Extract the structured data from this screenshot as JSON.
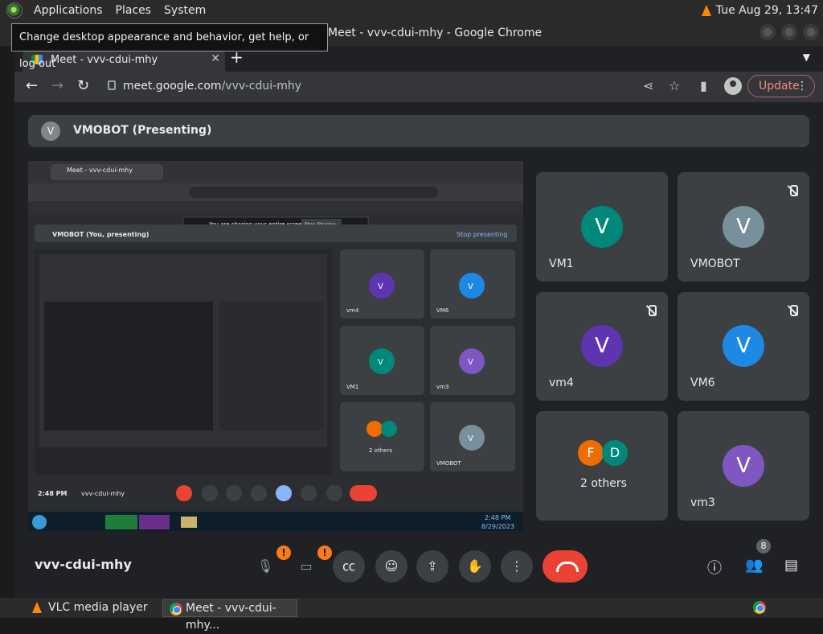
{
  "panel": {
    "menus": [
      "Applications",
      "Places",
      "System"
    ],
    "clock": "Tue Aug 29, 13:47"
  },
  "tooltip": "Change desktop appearance and behavior, get help, or log out",
  "window": {
    "title": "Meet - vvv-cdui-mhy - Google Chrome"
  },
  "browser": {
    "tab_title": "Meet - vvv-cdui-mhy",
    "url_host": "meet.google.com",
    "url_path": "/vvv-cdui-mhy",
    "update_label": "Update"
  },
  "meet": {
    "presenter_initial": "V",
    "presenter_label": "VMOBOT (Presenting)",
    "tiles": [
      {
        "name": "VM1",
        "initial": "V",
        "color": "#00897b",
        "muted": false
      },
      {
        "name": "VMOBOT",
        "initial": "V",
        "color": "#78909c",
        "muted": true
      },
      {
        "name": "vm4",
        "initial": "V",
        "color": "#5e35b1",
        "muted": true
      },
      {
        "name": "VM6",
        "initial": "V",
        "color": "#1e88e5",
        "muted": true
      },
      {
        "name": "2 others",
        "initials": [
          "F",
          "D"
        ],
        "colors": [
          "#ef6c00",
          "#00897b"
        ],
        "muted": false
      },
      {
        "name": "vm3",
        "initial": "V",
        "color": "#7e57c2",
        "muted": false
      }
    ],
    "shared_screen": {
      "nested_bar_label": "VMOBOT (You, presenting)",
      "sharing_notice": "You are sharing your entire screen.",
      "stop_sharing": "Stop Sharing",
      "stop_presenting": "Stop presenting",
      "nested_time": "2:48 PM",
      "nested_code": "vvv-cdui-mhy",
      "nested_tiles": [
        "vm4",
        "VM6",
        "VM1",
        "vm3",
        "2 others",
        "VMOBOT"
      ],
      "taskbar_time": "2:48 PM",
      "taskbar_date": "8/29/2023"
    }
  },
  "bottom": {
    "meeting_code": "vvv-cdui-mhy",
    "warning": "!",
    "people_count": "8"
  },
  "taskbar": {
    "items": [
      "VLC media player",
      "Meet - vvv-cdui-mhy..."
    ]
  }
}
